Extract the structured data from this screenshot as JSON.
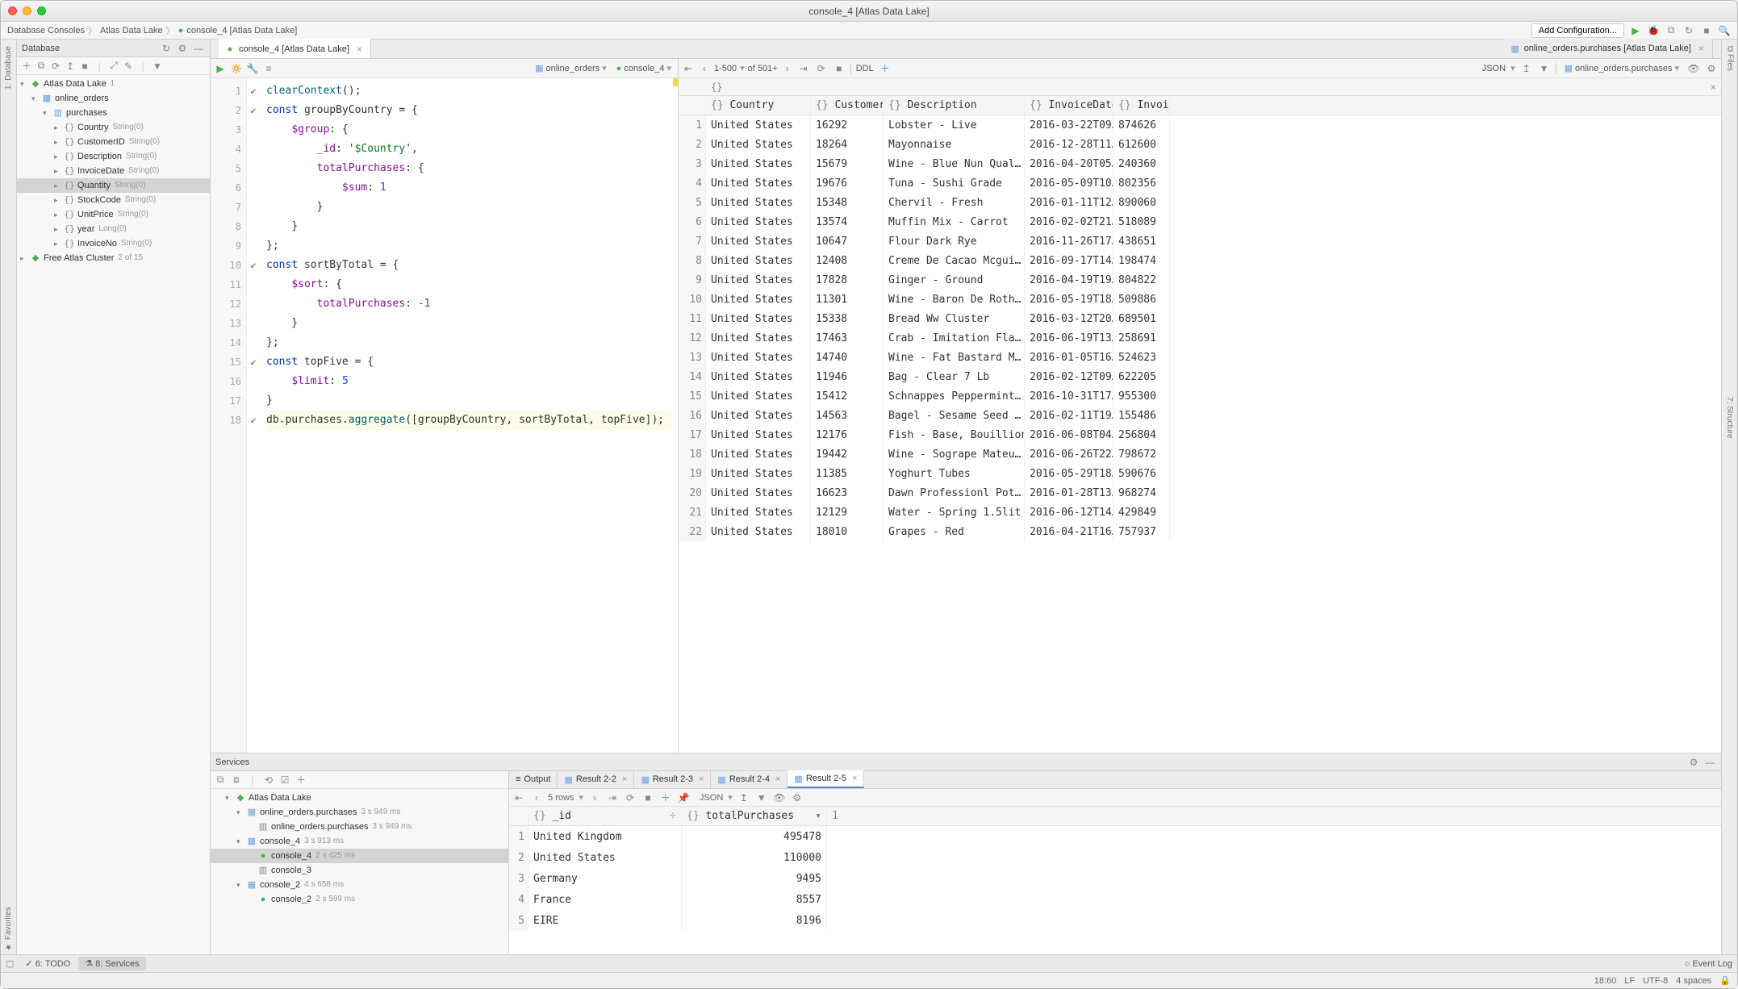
{
  "title": "console_4 [Atlas Data Lake]",
  "breadcrumbs": [
    "Database Consoles",
    "Atlas Data Lake",
    "console_4 [Atlas Data Lake]"
  ],
  "add_config": "Add Configuration...",
  "db_panel": {
    "title": "Database",
    "tree": {
      "root": {
        "label": "Atlas Data Lake",
        "meta": "1"
      },
      "db": {
        "label": "online_orders"
      },
      "coll": {
        "label": "purchases"
      },
      "fields": [
        {
          "label": "Country",
          "type": "String(0)"
        },
        {
          "label": "CustomerID",
          "type": "String(0)"
        },
        {
          "label": "Description",
          "type": "String(0)"
        },
        {
          "label": "InvoiceDate",
          "type": "String(0)"
        },
        {
          "label": "Quantity",
          "type": "String(0)"
        },
        {
          "label": "StockCode",
          "type": "String(0)"
        },
        {
          "label": "UnitPrice",
          "type": "String(0)"
        },
        {
          "label": "year",
          "type": "Long(0)"
        },
        {
          "label": "InvoiceNo",
          "type": "String(0)"
        }
      ],
      "second": {
        "label": "Free Atlas Cluster",
        "meta": "2 of 15"
      }
    }
  },
  "editor_tabs": [
    {
      "label": "console_4 [Atlas Data Lake]",
      "active": true
    },
    {
      "label": "online_orders.purchases [Atlas Data Lake]",
      "active": false
    }
  ],
  "editor_tb": {
    "schema": "online_orders",
    "console": "console_4"
  },
  "code": {
    "lines": [
      "clearContext();",
      "const groupByCountry = {",
      "    $group: {",
      "        _id: '$Country',",
      "        totalPurchases: {",
      "            $sum: 1",
      "        }",
      "    }",
      "};",
      "const sortByTotal = {",
      "    $sort: {",
      "        totalPurchases: -1",
      "    }",
      "};",
      "const topFive = {",
      "    $limit: 5",
      "}",
      "db.purchases.aggregate([groupByCountry, sortByTotal, topFive]);"
    ],
    "marks": [
      1,
      2,
      10,
      15,
      18
    ]
  },
  "results": {
    "toolbar": {
      "pager": "1-500",
      "of": "of 501+",
      "ddl": "DDL",
      "json": "JSON",
      "target": "online_orders.purchases"
    },
    "rootrow": "{}",
    "columns": [
      "Country",
      "CustomerID",
      "Description",
      "InvoiceDate",
      "Invoic"
    ],
    "rows": [
      [
        "United States",
        "16292",
        "Lobster - Live",
        "2016-03-22T09…",
        "874626"
      ],
      [
        "United States",
        "18264",
        "Mayonnaise",
        "2016-12-28T11…",
        "612600"
      ],
      [
        "United States",
        "15679",
        "Wine - Blue Nun Qual…",
        "2016-04-20T05…",
        "240360"
      ],
      [
        "United States",
        "19676",
        "Tuna - Sushi Grade",
        "2016-05-09T10…",
        "802356"
      ],
      [
        "United States",
        "15348",
        "Chervil - Fresh",
        "2016-01-11T12…",
        "890060"
      ],
      [
        "United States",
        "13574",
        "Muffin Mix - Carrot",
        "2016-02-02T21…",
        "518089"
      ],
      [
        "United States",
        "10647",
        "Flour Dark Rye",
        "2016-11-26T17…",
        "438651"
      ],
      [
        "United States",
        "12408",
        "Creme De Cacao Mcgui…",
        "2016-09-17T14…",
        "198474"
      ],
      [
        "United States",
        "17828",
        "Ginger - Ground",
        "2016-04-19T19…",
        "804822"
      ],
      [
        "United States",
        "11301",
        "Wine - Baron De Roth…",
        "2016-05-19T18…",
        "509886"
      ],
      [
        "United States",
        "15338",
        "Bread Ww Cluster",
        "2016-03-12T20…",
        "689501"
      ],
      [
        "United States",
        "17463",
        "Crab - Imitation Fla…",
        "2016-06-19T13…",
        "258691"
      ],
      [
        "United States",
        "14740",
        "Wine - Fat Bastard M…",
        "2016-01-05T16…",
        "524623"
      ],
      [
        "United States",
        "11946",
        "Bag - Clear 7 Lb",
        "2016-02-12T09…",
        "622205"
      ],
      [
        "United States",
        "15412",
        "Schnappes Peppermint…",
        "2016-10-31T17…",
        "955300"
      ],
      [
        "United States",
        "14563",
        "Bagel - Sesame Seed …",
        "2016-02-11T19…",
        "155486"
      ],
      [
        "United States",
        "12176",
        "Fish - Base, Bouillion",
        "2016-06-08T04…",
        "256804"
      ],
      [
        "United States",
        "19442",
        "Wine - Sograpе Mateu…",
        "2016-06-26T22…",
        "798672"
      ],
      [
        "United States",
        "11385",
        "Yoghurt Tubes",
        "2016-05-29T18…",
        "590676"
      ],
      [
        "United States",
        "16623",
        "Dawn Professionl Pot…",
        "2016-01-28T13…",
        "968274"
      ],
      [
        "United States",
        "12129",
        "Water - Spring 1.5lit",
        "2016-06-12T14…",
        "429849"
      ],
      [
        "United States",
        "18010",
        "Grapes - Red",
        "2016-04-21T16…",
        "757937"
      ]
    ]
  },
  "services": {
    "title": "Services",
    "tree": [
      {
        "label": "Atlas Data Lake",
        "indent": 1,
        "ico": "db"
      },
      {
        "label": "online_orders.purchases",
        "meta": "3 s 949 ms",
        "indent": 2,
        "ico": "console"
      },
      {
        "label": "online_orders.purchases",
        "meta": "3 s 949 ms",
        "indent": 3,
        "ico": "grid"
      },
      {
        "label": "console_4",
        "meta": "3 s 913 ms",
        "indent": 2,
        "ico": "console"
      },
      {
        "label": "console_4",
        "meta": "2 s 425 ms",
        "indent": 3,
        "ico": "run",
        "sel": true
      },
      {
        "label": "console_3",
        "indent": 3,
        "ico": "grid"
      },
      {
        "label": "console_2",
        "meta": "4 s 658 ms",
        "indent": 2,
        "ico": "console"
      },
      {
        "label": "console_2",
        "meta": "2 s 599 ms",
        "indent": 3,
        "ico": "run"
      }
    ],
    "tabs": [
      {
        "label": "Output",
        "ico": "out"
      },
      {
        "label": "Result 2-2",
        "ico": "grid"
      },
      {
        "label": "Result 2-3",
        "ico": "grid"
      },
      {
        "label": "Result 2-4",
        "ico": "grid"
      },
      {
        "label": "Result 2-5",
        "ico": "grid",
        "active": true
      }
    ],
    "results_tb": {
      "rows": "5 rows",
      "json": "JSON"
    },
    "grid": {
      "columns": [
        "_id",
        "totalPurchases"
      ],
      "suffix": "1",
      "rows": [
        [
          "United Kingdom",
          "495478"
        ],
        [
          "United States",
          "110000"
        ],
        [
          "Germany",
          "9495"
        ],
        [
          "France",
          "8557"
        ],
        [
          "EIRE",
          "8196"
        ]
      ]
    }
  },
  "bottom_tabs": {
    "todo": "6: TODO",
    "services": "8: Services",
    "eventlog": "Event Log"
  },
  "status": {
    "pos": "18:60",
    "sep": "LF",
    "enc": "UTF-8",
    "indent": "4 spaces"
  }
}
